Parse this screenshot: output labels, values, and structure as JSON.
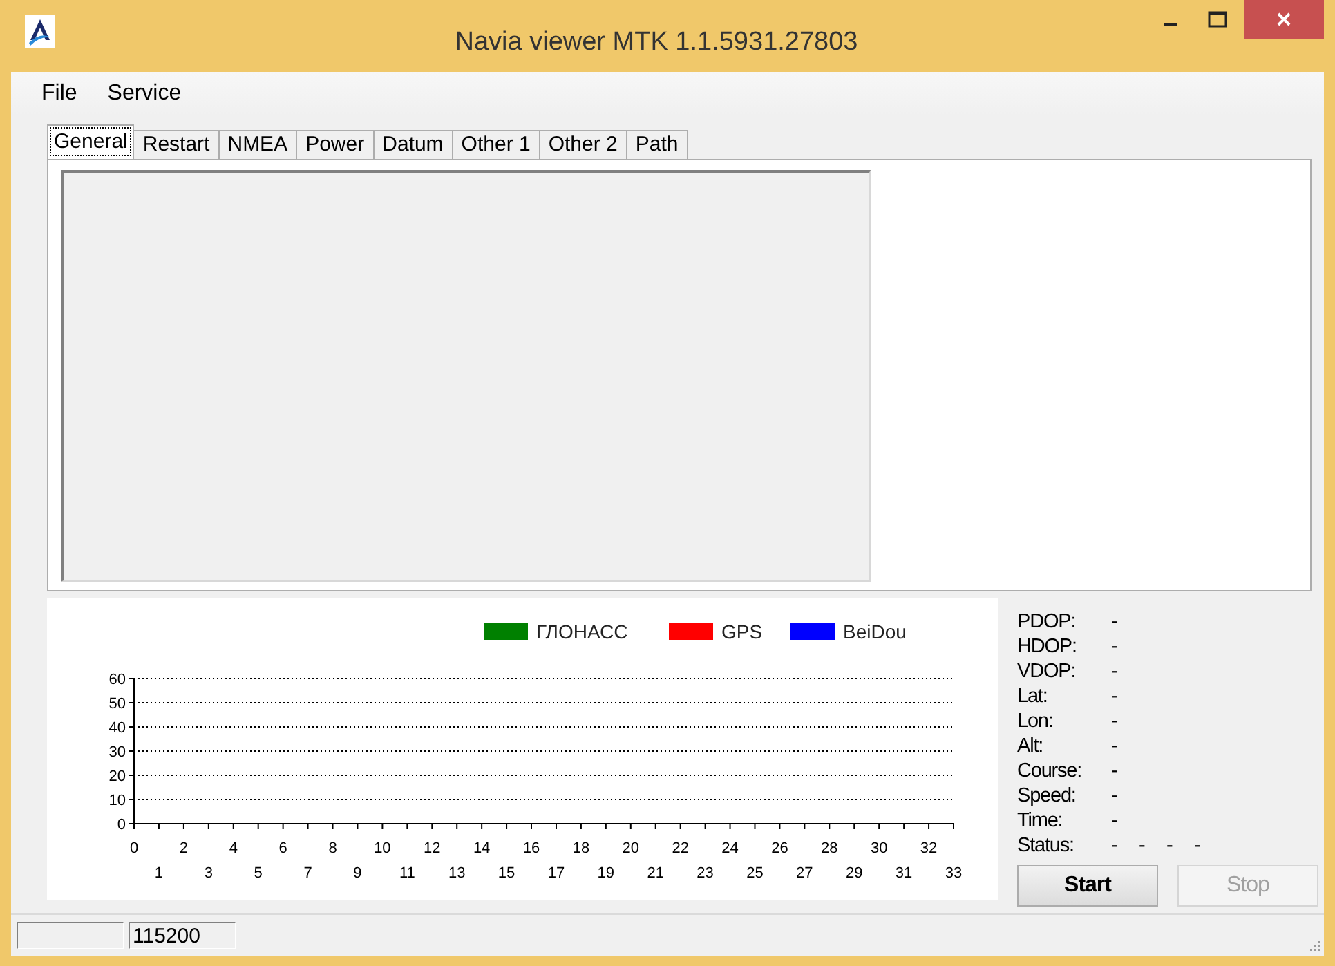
{
  "window": {
    "title": "Navia viewer MTK 1.1.5931.27803"
  },
  "menu": [
    "File",
    "Service"
  ],
  "tabs": [
    {
      "label": "General",
      "selected": true
    },
    {
      "label": "Restart",
      "selected": false
    },
    {
      "label": "NMEA",
      "selected": false
    },
    {
      "label": "Power",
      "selected": false
    },
    {
      "label": "Datum",
      "selected": false
    },
    {
      "label": "Other 1",
      "selected": false
    },
    {
      "label": "Other 2",
      "selected": false
    },
    {
      "label": "Path",
      "selected": false
    }
  ],
  "chart": {
    "chart_data": {
      "type": "bar",
      "ylim": [
        0,
        60
      ],
      "grid": true,
      "categories": [
        "0",
        "1",
        "2",
        "3",
        "4",
        "5",
        "6",
        "7",
        "8",
        "9",
        "10",
        "11",
        "12",
        "13",
        "14",
        "15",
        "16",
        "17",
        "18",
        "19",
        "20",
        "21",
        "22",
        "23",
        "24",
        "25",
        "26",
        "27",
        "28",
        "29",
        "30",
        "31",
        "32",
        "33"
      ],
      "yticks": [
        0,
        10,
        20,
        30,
        40,
        50,
        60
      ],
      "series": [
        {
          "name": "ГЛОНАСС",
          "color": "#008000",
          "values": [
            null,
            null,
            null,
            null,
            null,
            null,
            null,
            null,
            null,
            null,
            null,
            null,
            null,
            null,
            null,
            null,
            null,
            null,
            null,
            null,
            null,
            null,
            null,
            null,
            null,
            null,
            null,
            null,
            null,
            null,
            null,
            null,
            null,
            null
          ]
        },
        {
          "name": "GPS",
          "color": "#ff0000",
          "values": [
            null,
            null,
            null,
            null,
            null,
            null,
            null,
            null,
            null,
            null,
            null,
            null,
            null,
            null,
            null,
            null,
            null,
            null,
            null,
            null,
            null,
            null,
            null,
            null,
            null,
            null,
            null,
            null,
            null,
            null,
            null,
            null,
            null,
            null
          ]
        },
        {
          "name": "BeiDou",
          "color": "#0000ff",
          "values": [
            null,
            null,
            null,
            null,
            null,
            null,
            null,
            null,
            null,
            null,
            null,
            null,
            null,
            null,
            null,
            null,
            null,
            null,
            null,
            null,
            null,
            null,
            null,
            null,
            null,
            null,
            null,
            null,
            null,
            null,
            null,
            null,
            null,
            null
          ]
        }
      ]
    }
  },
  "info": [
    {
      "label": "PDOP:",
      "values": [
        "-"
      ]
    },
    {
      "label": "HDOP:",
      "values": [
        "-"
      ]
    },
    {
      "label": "VDOP:",
      "values": [
        "-"
      ]
    },
    {
      "label": "Lat:",
      "values": [
        "-"
      ]
    },
    {
      "label": "Lon:",
      "values": [
        "-"
      ]
    },
    {
      "label": "Alt:",
      "values": [
        "-"
      ]
    },
    {
      "label": "Course:",
      "values": [
        "-"
      ]
    },
    {
      "label": "Speed:",
      "values": [
        "-"
      ]
    },
    {
      "label": "Time:",
      "values": [
        "-"
      ]
    },
    {
      "label": "Status:",
      "values": [
        "-",
        "-",
        "-",
        "-"
      ]
    }
  ],
  "buttons": [
    {
      "label": "Start",
      "disabled": false
    },
    {
      "label": "Stop",
      "disabled": true
    }
  ],
  "status_bar": {
    "baud_rate": "115200"
  }
}
